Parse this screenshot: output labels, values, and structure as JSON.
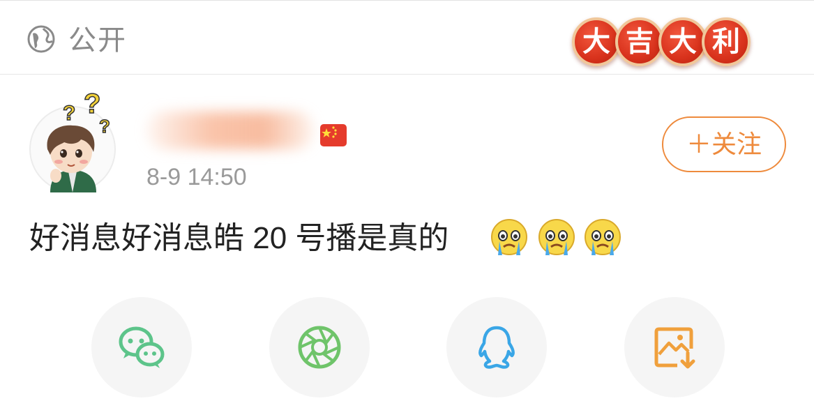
{
  "header": {
    "visibility_label": "公开",
    "visibility_icon": "globe-icon",
    "festive_badges": [
      "大",
      "吉",
      "大",
      "利"
    ]
  },
  "post": {
    "author_region_flag": "flag-china-icon",
    "timestamp": "8-9 14:50",
    "follow_button": "＋关注",
    "text": "好消息好消息皓 20 号播是真的",
    "emojis": [
      "crying-face-icon",
      "crying-face-icon",
      "crying-face-icon"
    ]
  },
  "share": {
    "items": [
      {
        "icon": "wechat-icon",
        "color": "#5dc48a"
      },
      {
        "icon": "moments-icon",
        "color": "#6fc46a"
      },
      {
        "icon": "qq-icon",
        "color": "#3aa6e6"
      },
      {
        "icon": "save-image-icon",
        "color": "#f0a03c"
      }
    ]
  },
  "colors": {
    "accent": "#ee8a3c",
    "badge_red": "#d8321c",
    "muted_text": "#9a9a9a"
  }
}
